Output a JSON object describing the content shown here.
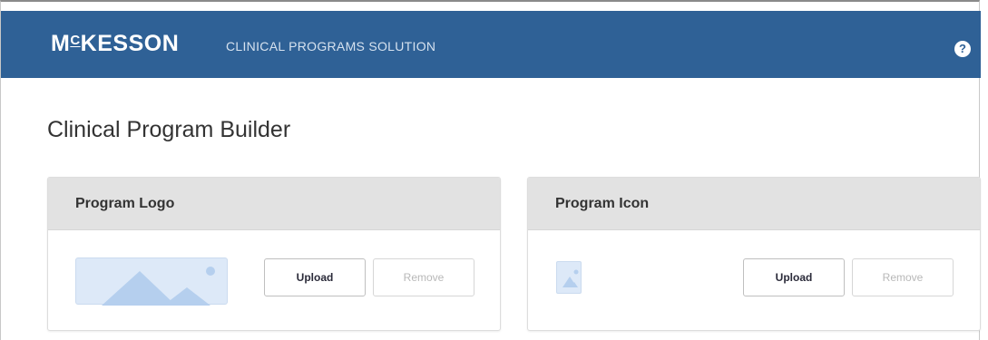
{
  "header": {
    "brand": "McKESSON",
    "subtitle": "CLINICAL PROGRAMS SOLUTION",
    "help_icon": "question-mark-icon",
    "help_label": "?",
    "background_color": "#2f6196"
  },
  "page": {
    "title": "Clinical Program Builder"
  },
  "cards": [
    {
      "title": "Program Logo",
      "placeholder_icon": "image-placeholder-icon",
      "upload_label": "Upload",
      "remove_label": "Remove"
    },
    {
      "title": "Program Icon",
      "placeholder_icon": "image-placeholder-icon",
      "upload_label": "Upload",
      "remove_label": "Remove"
    }
  ]
}
